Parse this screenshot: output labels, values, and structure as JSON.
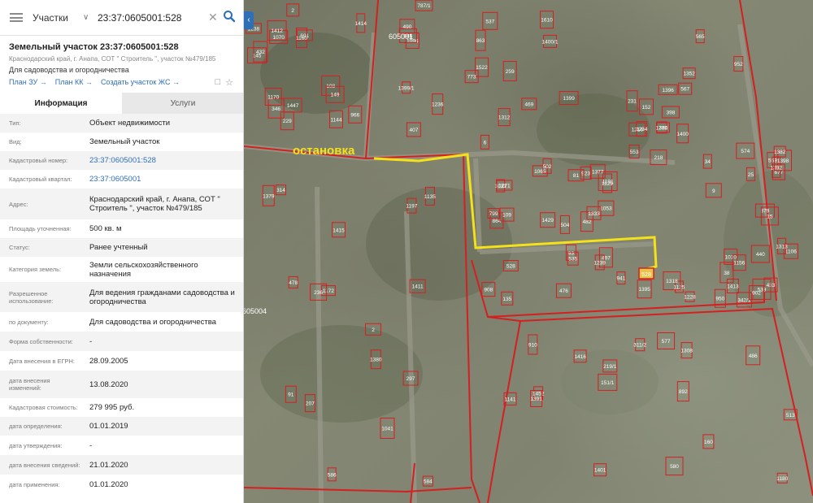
{
  "search": {
    "layer": "Участки",
    "query": "23:37:0605001:528"
  },
  "header": {
    "title": "Земельный участок 23:37:0605001:528",
    "address_short": "Краснодарский край, г. Анапа, СОТ \" Строитель \", участок №479/185",
    "usage": "Для садоводства и огородничества"
  },
  "actions": {
    "plan_zu": "План ЗУ →",
    "plan_kk": "План КК →",
    "create_zhs": "Создать участок ЖС →"
  },
  "tabs": [
    "Информация",
    "Услуги"
  ],
  "info_rows": [
    {
      "label": "Тип:",
      "value": "Объект недвижимости"
    },
    {
      "label": "Вид:",
      "value": "Земельный участок"
    },
    {
      "label": "Кадастровый номер:",
      "value": "23:37:0605001:528"
    },
    {
      "label": "Кадастровый квартал:",
      "value": "23:37:0605001"
    },
    {
      "label": "Адрес:",
      "value": "Краснодарский край, г. Анапа, СОТ \" Строитель \", участок №479/185"
    },
    {
      "label": "Площадь уточненная:",
      "value": "500 кв. м"
    },
    {
      "label": "Статус:",
      "value": "Ранее учтенный"
    },
    {
      "label": "Категория земель:",
      "value": "Земли сельскохозяйственного назначения"
    },
    {
      "label": "Разрешенное использование:",
      "value": "Для ведения гражданами садоводства и огородничества"
    },
    {
      "label": "по документу:",
      "value": "Для садоводства и огородничества"
    },
    {
      "label": "Форма собственности:",
      "value": "-"
    },
    {
      "label": "Дата внесения в ЕГРН:",
      "value": "28.09.2005"
    },
    {
      "label": "дата внесения изменений:",
      "value": "13.08.2020"
    },
    {
      "label": "Кадастровая стоимость:",
      "value": "279 995 руб."
    },
    {
      "label": "дата определения:",
      "value": "01.01.2019"
    },
    {
      "label": "дата утверждения:",
      "value": "-"
    },
    {
      "label": "дата внесения сведений:",
      "value": "21.01.2020"
    },
    {
      "label": "дата применения:",
      "value": "01.01.2020"
    }
  ],
  "map": {
    "stop_label": "остановка",
    "block_labels": [
      "605001",
      "605004"
    ],
    "selected_parcel": "528",
    "parcel_labels": [
      "1096",
      "864",
      "476",
      "691",
      "2",
      "1180",
      "952",
      "677",
      "863",
      "109",
      "135",
      "1160",
      "297",
      "311/2",
      "34",
      "379",
      "1522",
      "923",
      "950",
      "108",
      "1172",
      "160",
      "231",
      "342/1",
      "259",
      "1129",
      "1125",
      "346",
      "314",
      "486",
      "775",
      "25",
      "787/1",
      "1065",
      "908",
      "229",
      "236",
      "910",
      "553",
      "433",
      "407",
      "1053",
      "38",
      "1144",
      "1041",
      "513",
      "9",
      "1106",
      "6",
      "81",
      "93",
      "145",
      "207",
      "892",
      "398",
      "574",
      "773",
      "799",
      "1010",
      "2",
      "1135",
      "219/1",
      "218",
      "539",
      "946",
      "504",
      "535",
      "149",
      "91",
      "151/1",
      "152",
      "15",
      "490",
      "482",
      "497",
      "1070",
      "586",
      "577",
      "567",
      "559",
      "537",
      "502",
      "528",
      "966",
      "584",
      "580",
      "565",
      "902",
      "469",
      "1031",
      "941",
      "432",
      "478",
      "1452",
      "1400",
      "440",
      "1400/1",
      "1429",
      "1239",
      "1170",
      "1197",
      "1141",
      "1216",
      "1156",
      "1610",
      "1191",
      "1413",
      "1447",
      "1380",
      "1391",
      "1352",
      "1392",
      "1236",
      "1377",
      "1228",
      "1238",
      "1379",
      "1308",
      "1234",
      "1313",
      "1399",
      "1271",
      "1395",
      "1412",
      "1411",
      "1401",
      "1396",
      "1398",
      "1312",
      "1333",
      "1318",
      "1414",
      "1415",
      "1416",
      "1384",
      "1382",
      "1399/1"
    ]
  }
}
